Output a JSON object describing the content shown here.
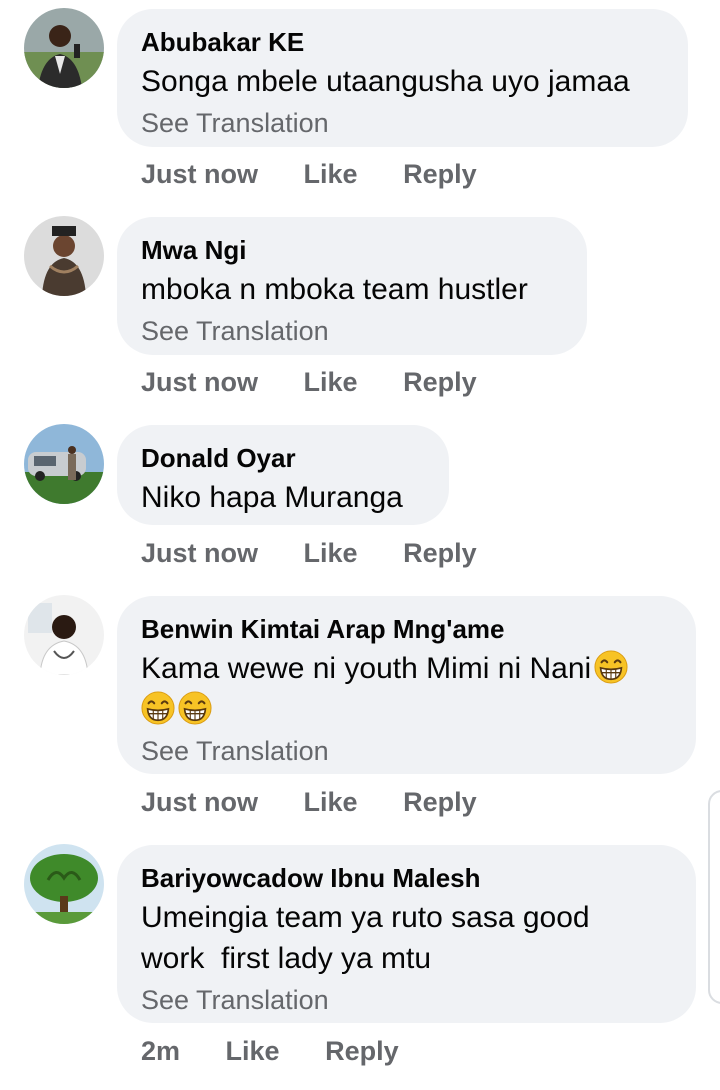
{
  "comments": [
    {
      "author": "Abubakar KE",
      "text": "Songa mbele utaangusha uyo jamaa",
      "translate": "See Translation",
      "time": "Just now",
      "like": "Like",
      "reply": "Reply"
    },
    {
      "author": "Mwa Ngi",
      "text": "mboka n mboka team hustler",
      "translate": "See Translation",
      "time": "Just now",
      "like": "Like",
      "reply": "Reply"
    },
    {
      "author": "Donald Oyar",
      "text": "Niko hapa Muranga",
      "time": "Just now",
      "like": "Like",
      "reply": "Reply"
    },
    {
      "author": "Benwin Kimtai Arap Mng'ame",
      "text": "Kama wewe ni youth Mimi ni Nani",
      "emoji": "grinning-face-emoji",
      "translate": "See Translation",
      "time": "Just now",
      "like": "Like",
      "reply": "Reply"
    },
    {
      "author": "Bariyowcadow Ibnu Malesh",
      "text_line1": "Umeingia team ya ruto sasa good",
      "text_line2": "work  first lady ya mtu",
      "translate": "See Translation",
      "time": "2m",
      "like": "Like",
      "reply": "Reply"
    }
  ],
  "colors": {
    "bubble": "#f0f2f5",
    "text": "#050505",
    "secondary": "#65676b"
  }
}
